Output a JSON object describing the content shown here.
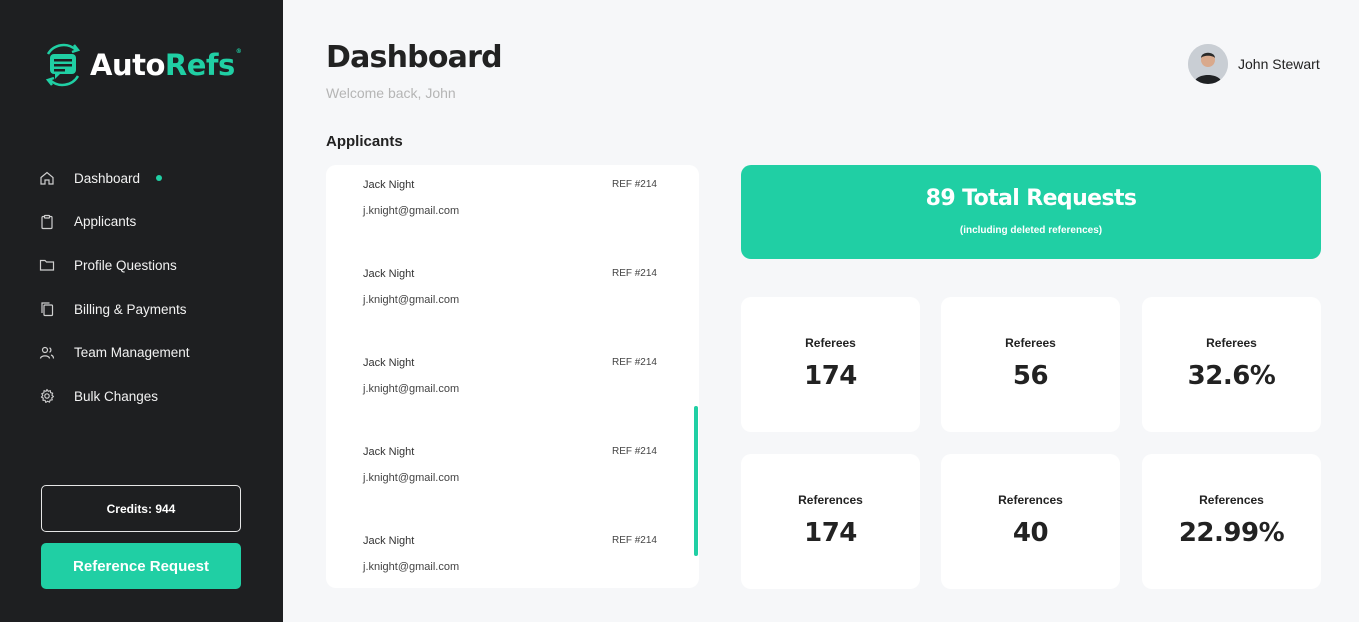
{
  "logo": {
    "part1": "Auto",
    "part2": "Refs",
    "reg": "®"
  },
  "sidebar": {
    "items": [
      {
        "label": "Dashboard",
        "icon": "home-icon",
        "active": true
      },
      {
        "label": "Applicants",
        "icon": "clipboard-icon"
      },
      {
        "label": "Profile Questions",
        "icon": "folder-icon"
      },
      {
        "label": "Billing & Payments",
        "icon": "copy-icon"
      },
      {
        "label": "Team Management",
        "icon": "users-icon"
      },
      {
        "label": "Bulk Changes",
        "icon": "gear-icon"
      }
    ],
    "credits_label": "Credits: 944",
    "reference_button": "Reference Request"
  },
  "header": {
    "title": "Dashboard",
    "welcome": "Welcome back, John",
    "user_name": "John Stewart"
  },
  "applicants": {
    "title": "Applicants",
    "items": [
      {
        "name": "Jack Night",
        "email": "j.knight@gmail.com",
        "ref": "REF #214"
      },
      {
        "name": "Jack Night",
        "email": "j.knight@gmail.com",
        "ref": "REF #214"
      },
      {
        "name": "Jack Night",
        "email": "j.knight@gmail.com",
        "ref": "REF #214"
      },
      {
        "name": "Jack Night",
        "email": "j.knight@gmail.com",
        "ref": "REF #214"
      },
      {
        "name": "Jack Night",
        "email": "j.knight@gmail.com",
        "ref": "REF #214"
      }
    ]
  },
  "summary": {
    "title": "89 Total Requests",
    "subtitle": "(including deleted references)"
  },
  "stats": [
    {
      "label": "Referees",
      "value": "174"
    },
    {
      "label": "Referees",
      "value": "56"
    },
    {
      "label": "Referees",
      "value": "32.6%"
    },
    {
      "label": "References",
      "value": "174"
    },
    {
      "label": "References",
      "value": "40"
    },
    {
      "label": "References",
      "value": "22.99%"
    }
  ],
  "colors": {
    "accent": "#20cfa4",
    "sidebar_bg": "#1e1f21",
    "page_bg": "#f6f7f9"
  }
}
